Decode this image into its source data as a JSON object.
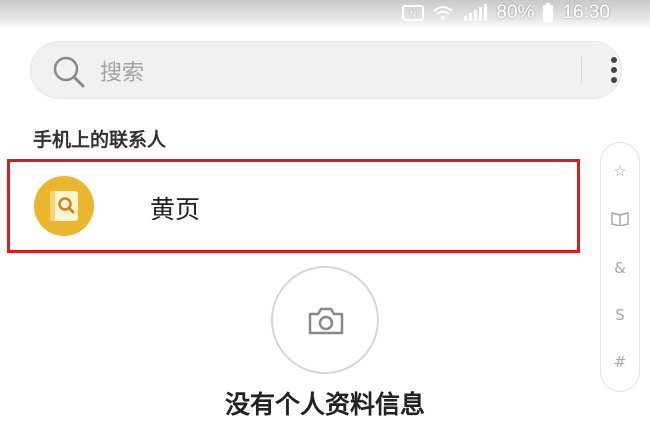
{
  "status_bar": {
    "battery_level": "80%",
    "time": "16:30",
    "icons": [
      "nfc-icon",
      "wifi-icon",
      "signal-icon",
      "battery-icon"
    ]
  },
  "search": {
    "placeholder": "搜索",
    "icons": [
      "search-icon",
      "more-vertical-icon"
    ]
  },
  "contacts_section": {
    "heading": "手机上的联系人",
    "items": [
      {
        "name": "黄页",
        "icon": "yellow-pages-icon",
        "avatar_color": "#eab62c"
      }
    ]
  },
  "index_bar": {
    "items": [
      "☆",
      "📖",
      "&",
      "S",
      "#"
    ]
  },
  "profile": {
    "icon": "camera-icon",
    "empty_text": "没有个人资料信息"
  },
  "colors": {
    "highlight_border": "#d41e1e",
    "avatar": "#eab62c"
  }
}
